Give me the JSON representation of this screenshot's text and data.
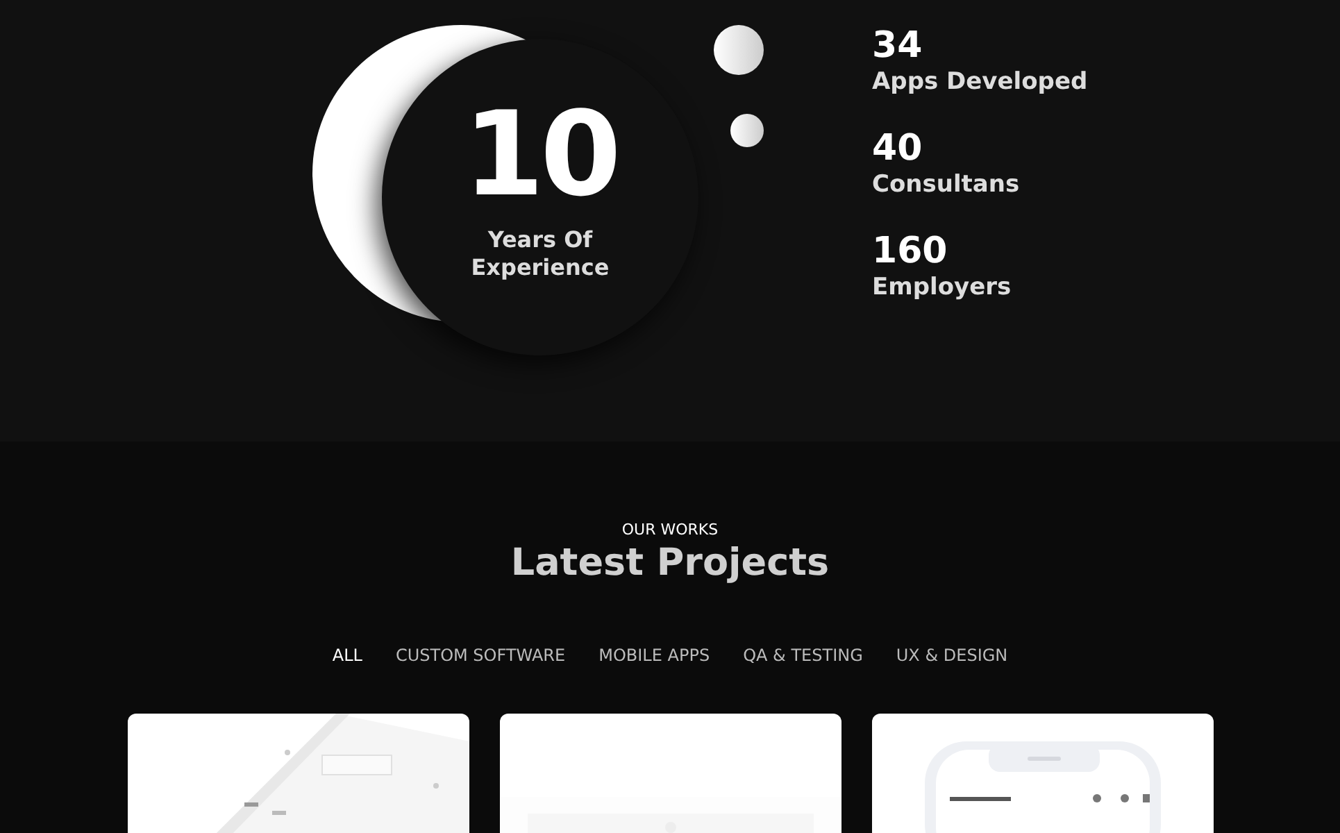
{
  "experience": {
    "number": "10",
    "label_line_1": "Years Of",
    "label_line_2": "Experience"
  },
  "stats": [
    {
      "value": "34",
      "label": "Apps Developed"
    },
    {
      "value": "40",
      "label": "Consultans"
    },
    {
      "value": "160",
      "label": "Employers"
    }
  ],
  "works": {
    "eyebrow": "OUR WORKS",
    "title": "Latest Projects"
  },
  "filters": [
    {
      "label": "ALL",
      "selected": true
    },
    {
      "label": "CUSTOM SOFTWARE",
      "selected": false
    },
    {
      "label": "MOBILE APPS",
      "selected": false
    },
    {
      "label": "QA & TESTING",
      "selected": false
    },
    {
      "label": "UX & DESIGN",
      "selected": false
    }
  ]
}
